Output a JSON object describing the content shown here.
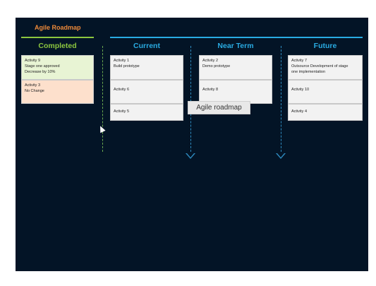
{
  "slide": {
    "title": "Agile Roadmap",
    "tooltip": "Agile roadmap"
  },
  "columns": {
    "completed": {
      "label": "Completed",
      "cards": [
        {
          "line1": "Activity 9",
          "line2": "Stage one approved",
          "line3": "Decrease by 10%"
        },
        {
          "line1": "Activity 3",
          "line2": "No Change",
          "line3": ""
        }
      ]
    },
    "current": {
      "label": "Current",
      "cards": [
        {
          "line1": "Activity 1",
          "line2": "Build prototype",
          "line3": ""
        },
        {
          "line1": "Activity 6",
          "line2": "",
          "line3": ""
        },
        {
          "line1": "Activity 5",
          "line2": "",
          "line3": ""
        }
      ]
    },
    "near_term": {
      "label": "Near Term",
      "cards": [
        {
          "line1": "Activity 2",
          "line2": "Demo prototype",
          "line3": ""
        },
        {
          "line1": "Activity 8",
          "line2": "",
          "line3": ""
        }
      ]
    },
    "future": {
      "label": "Future",
      "cards": [
        {
          "line1": "Activity 7",
          "line2": "Outsource Development of stage",
          "line3": "one implementation"
        },
        {
          "line1": "Activity 10",
          "line2": "",
          "line3": ""
        },
        {
          "line1": "Activity 4",
          "line2": "",
          "line3": ""
        }
      ]
    }
  },
  "colors": {
    "background": "#031426",
    "completed_accent": "#8cc63f",
    "upcoming_accent": "#29abe2",
    "title_accent": "#ee8a3a"
  }
}
